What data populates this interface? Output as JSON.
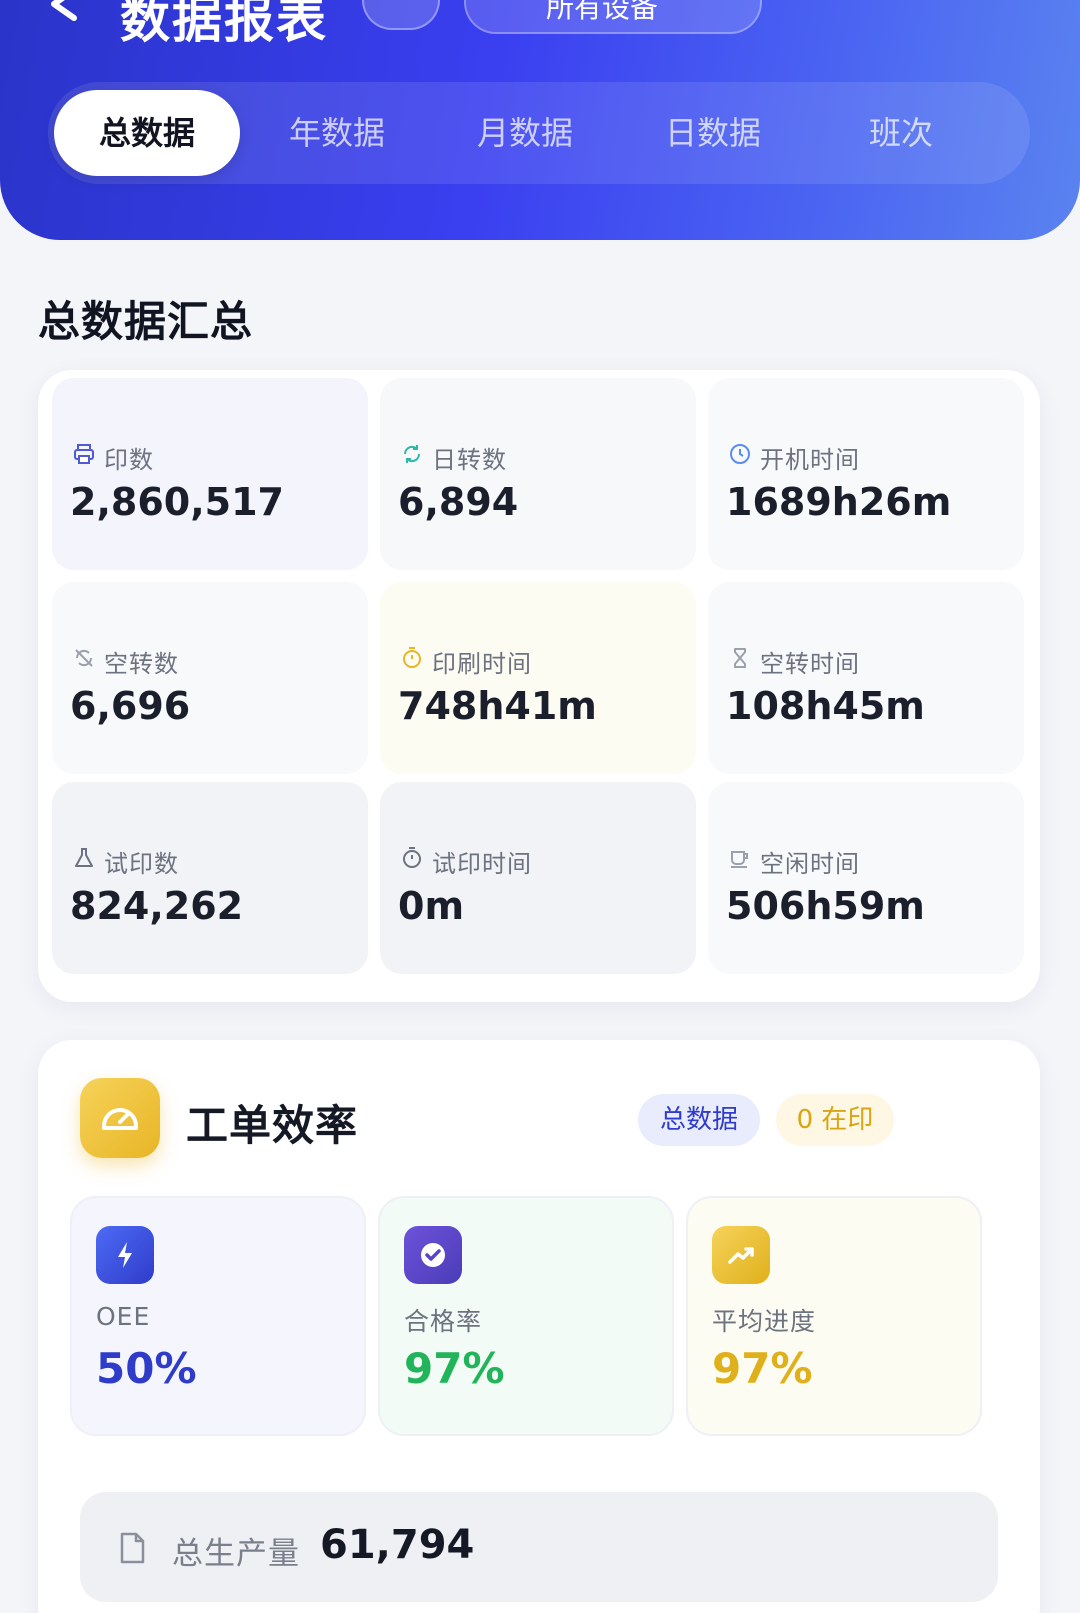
{
  "header": {
    "title": "数据报表",
    "device_selector": "所有设备",
    "tabs": [
      "总数据",
      "年数据",
      "月数据",
      "日数据",
      "班次"
    ],
    "active_tab": "总数据"
  },
  "summary": {
    "title": "总数据汇总",
    "stats": [
      {
        "label": "印数",
        "value": "2,860,517",
        "icon": "printer-icon",
        "icon_color": "#4f5bd5"
      },
      {
        "label": "日转数",
        "value": "6,894",
        "icon": "rotate-icon",
        "icon_color": "#2fb7a8"
      },
      {
        "label": "开机时间",
        "value": "1689h26m",
        "icon": "clock-icon",
        "icon_color": "#5b8cf0"
      },
      {
        "label": "空转数",
        "value": "6,696",
        "icon": "idle-rotate-icon",
        "icon_color": "#9aa0ad"
      },
      {
        "label": "印刷时间",
        "value": "748h41m",
        "icon": "stopwatch-icon",
        "icon_color": "#e8b526"
      },
      {
        "label": "空转时间",
        "value": "108h45m",
        "icon": "hourglass-icon",
        "icon_color": "#9aa0ad"
      },
      {
        "label": "试印数",
        "value": "824,262",
        "icon": "flask-icon",
        "icon_color": "#6d7281"
      },
      {
        "label": "试印时间",
        "value": "0m",
        "icon": "timer-icon",
        "icon_color": "#6d7281"
      },
      {
        "label": "空闲时间",
        "value": "506h59m",
        "icon": "coffee-icon",
        "icon_color": "#9aa0ad"
      }
    ]
  },
  "efficiency": {
    "title": "工单效率",
    "badge_scope": "总数据",
    "badge_printing": "0 在印",
    "metrics": [
      {
        "label": "OEE",
        "value": "50%",
        "icon": "bolt-icon",
        "color": "#2f3cc9"
      },
      {
        "label": "合格率",
        "value": "97%",
        "icon": "verified-icon",
        "color": "#22b45a"
      },
      {
        "label": "平均进度",
        "value": "97%",
        "icon": "trend-up-icon",
        "color": "#e0b01c"
      }
    ],
    "total_label": "总生产量",
    "total_value": "61,794"
  },
  "colors": {
    "primary": "#3a3ff0",
    "green": "#22b45a",
    "yellow": "#e0b01c"
  }
}
